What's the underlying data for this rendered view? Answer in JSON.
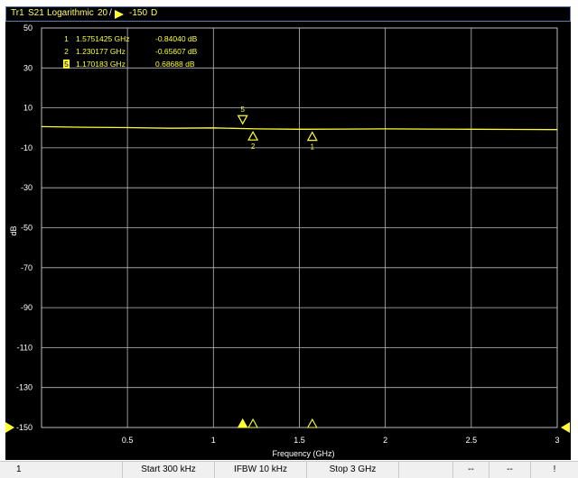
{
  "trace_header": {
    "trace": "Tr1",
    "parameter": "S21",
    "format": "Logarithmic",
    "scale": "20",
    "ref_value": "-150",
    "ref_suffix": "D"
  },
  "markers": [
    {
      "id": "1",
      "freq": "1.5751425 GHz",
      "value": "-0.84040 dB",
      "x": 1.5751425,
      "y": -0.8404,
      "active": false
    },
    {
      "id": "2",
      "freq": "1.230177 GHz",
      "value": "-0.65607 dB",
      "x": 1.230177,
      "y": -0.65607,
      "active": false
    },
    {
      "id": "5",
      "freq": "1.170183 GHz",
      "value": "0.68688 dB",
      "x": 1.170183,
      "y": 0.68688,
      "active": true
    }
  ],
  "chart_data": {
    "type": "line",
    "xlabel": "Frequency (GHz)",
    "ylabel": "dB",
    "xlim": [
      0.0003,
      3
    ],
    "ylim": [
      -150,
      50
    ],
    "xticks": [
      "0.5",
      "1",
      "1.5",
      "2",
      "2.5",
      "3"
    ],
    "xtick_values": [
      0.5,
      1,
      1.5,
      2,
      2.5,
      3
    ],
    "yticks": [
      "50",
      "30",
      "10",
      "-10",
      "-30",
      "-50",
      "-70",
      "-90",
      "-110",
      "-130",
      "-150"
    ],
    "ytick_values": [
      50,
      30,
      10,
      -10,
      -30,
      -50,
      -70,
      -90,
      -110,
      -130,
      -150
    ],
    "grid": true,
    "series": [
      {
        "name": "Tr1 S21",
        "color": "#ffff33",
        "x": [
          0.0003,
          0.25,
          0.5,
          0.75,
          1.0,
          1.25,
          1.5,
          1.75,
          2.0,
          2.25,
          2.5,
          2.75,
          3.0
        ],
        "y": [
          0.6,
          0.3,
          0.1,
          -0.2,
          0.0,
          -0.5,
          -0.7,
          -0.6,
          -0.5,
          -0.6,
          -0.7,
          -0.8,
          -0.9
        ]
      }
    ]
  },
  "status_bar": {
    "channel": "1",
    "start": "Start 300 kHz",
    "ifbw": "IFBW 10 kHz",
    "stop": "Stop 3 GHz",
    "field1": "--",
    "field2": "--",
    "field3": "!"
  }
}
